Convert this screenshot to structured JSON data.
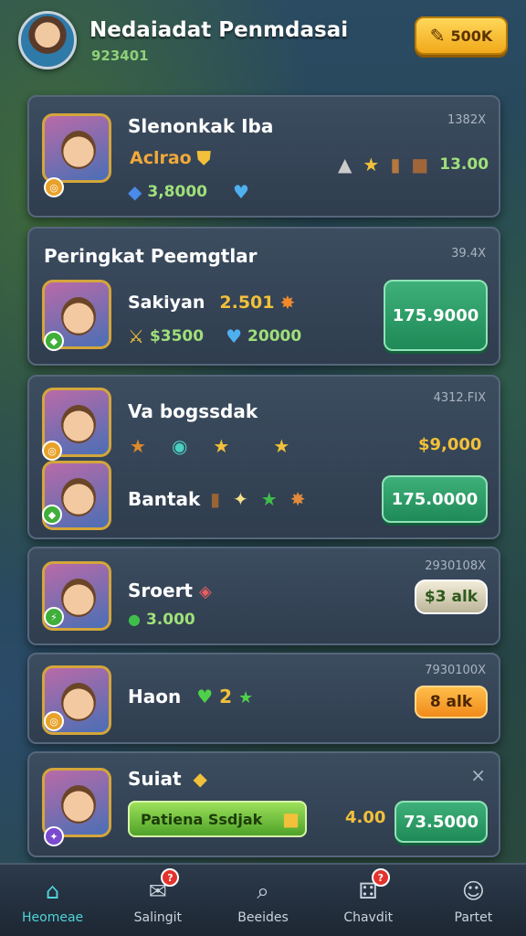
{
  "header": {
    "title": "Nedaiadat Penmdasai",
    "subtitle": "923401",
    "button_label": "500K",
    "button_icon": "coin-icon"
  },
  "cards": [
    {
      "name": "Slenonkak Iba",
      "rank_label": "Aclrao",
      "corner": "1382X",
      "stat1": "3,8000",
      "items_value": "13.00"
    },
    {
      "name": "Peringkat Peemgtlar",
      "sub_name": "Sakiyan",
      "sub_value": "2.501",
      "stat1": "$3500",
      "stat2": "20000",
      "corner": "39.4X",
      "button_label": "175.9000"
    },
    {
      "name": "Va bogssdak",
      "sub_name": "Bantak",
      "corner": "4312.FIX",
      "value": "$9,000",
      "button_label": "175.0000"
    },
    {
      "name": "Sroert",
      "stat1": "3.000",
      "corner": "2930108X",
      "button_label": "$3 alk"
    },
    {
      "name": "Haon",
      "stat1": "2",
      "corner": "7930100X",
      "button_label": "8 alk"
    },
    {
      "name": "Suiat",
      "bar_label": "Patiena Ssdjak",
      "value": "4.00",
      "button_label": "73.5000",
      "close": "×"
    }
  ],
  "nav": [
    {
      "label": "Heomeae",
      "icon": "home-icon",
      "active": true
    },
    {
      "label": "Salingit",
      "icon": "mail-icon",
      "badge": "?"
    },
    {
      "label": "Beeides",
      "icon": "search-icon"
    },
    {
      "label": "Chavdit",
      "icon": "dice-icon",
      "badge": "?"
    },
    {
      "label": "Partet",
      "icon": "profile-icon"
    }
  ],
  "colors": {
    "accent_green": "#1e8a57",
    "accent_gold": "#f1a919",
    "nav_active": "#4fd3d9"
  }
}
